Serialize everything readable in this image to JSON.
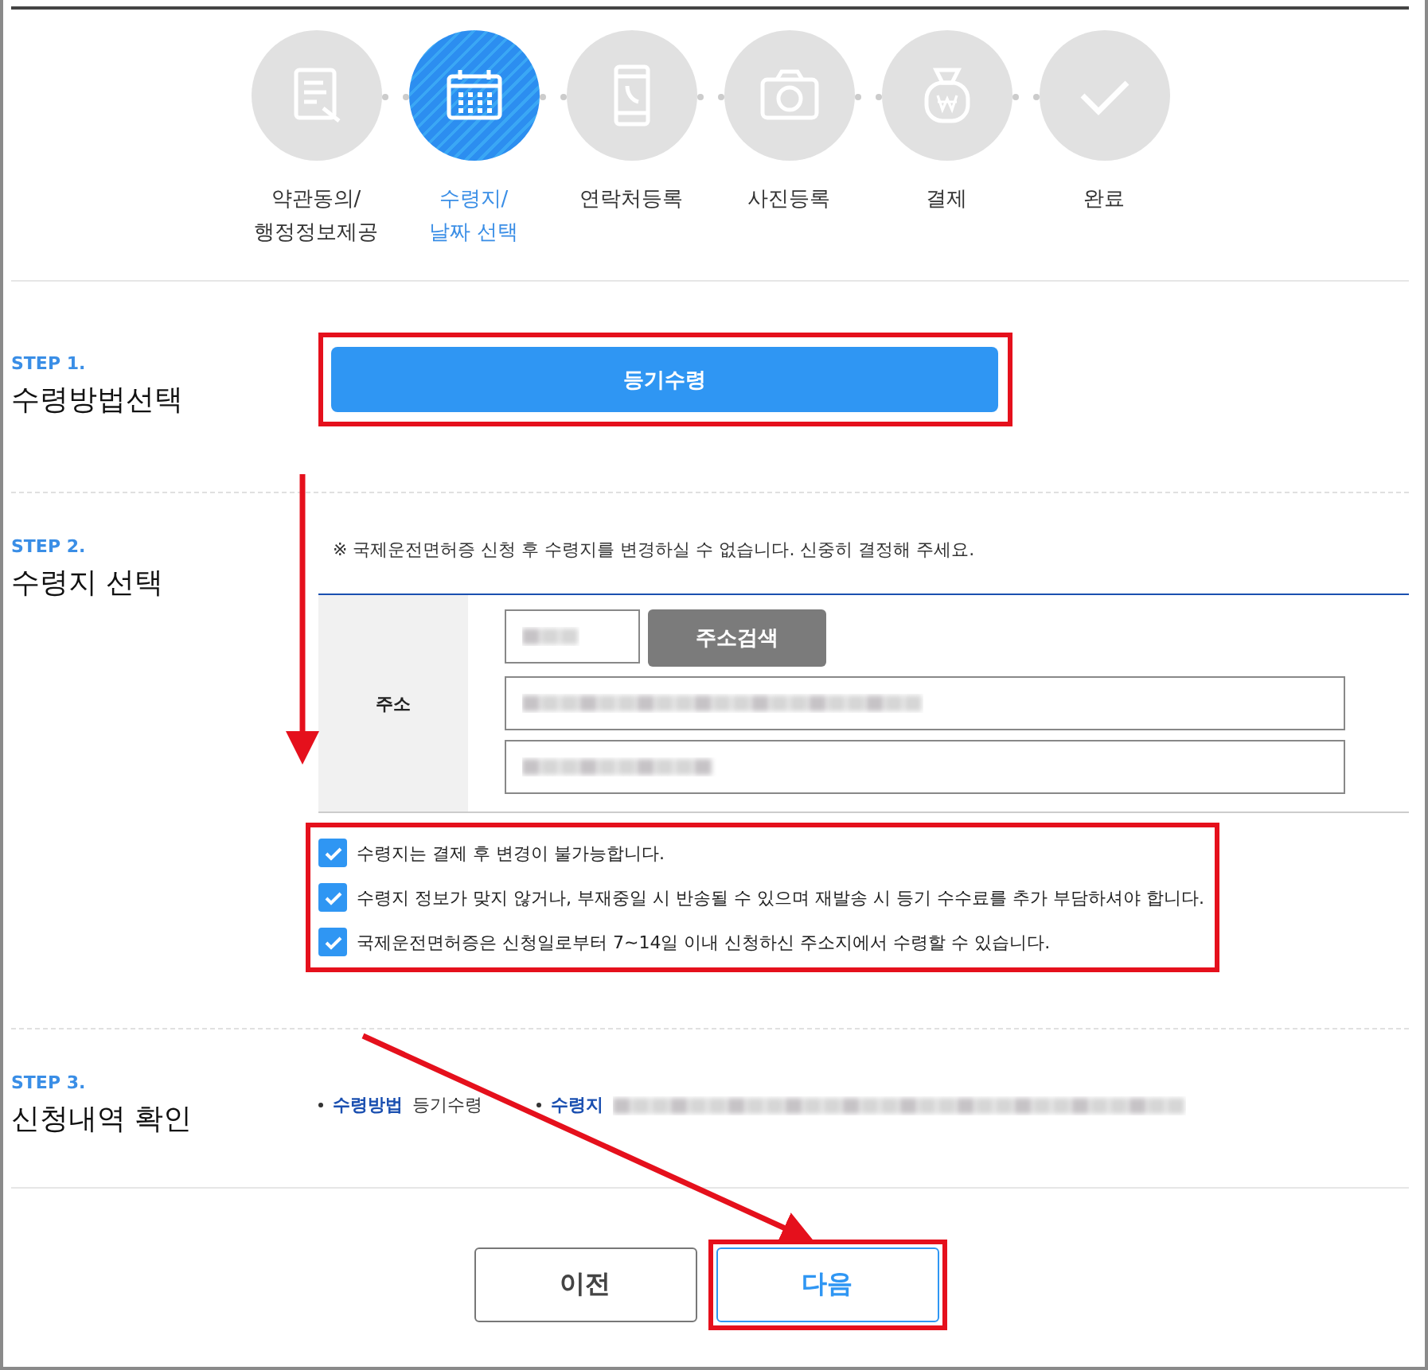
{
  "progress": [
    {
      "label": "약관동의/\n행정정보제공",
      "selected": false
    },
    {
      "label": "수령지/\n날짜 선택",
      "selected": true
    },
    {
      "label": "연락처등록",
      "selected": false
    },
    {
      "label": "사진등록",
      "selected": false
    },
    {
      "label": "결제",
      "selected": false
    },
    {
      "label": "완료",
      "selected": false
    }
  ],
  "step1": {
    "step": "STEP 1.",
    "title": "수령방법선택",
    "method_button": "등기수령"
  },
  "step2": {
    "step": "STEP 2.",
    "title": "수령지 선택",
    "notice": "※ 국제운전면허증 신청 후 수령지를 변경하실 수 없습니다. 신중히 결정해 주세요.",
    "address_label": "주소",
    "search_button": "주소검색",
    "agreements": [
      {
        "text": "수령지는 결제 후 변경이 불가능합니다.",
        "checked": true
      },
      {
        "text": "수령지 정보가 맞지 않거나, 부재중일 시 반송될 수 있으며 재발송 시 등기 수수료를 추가 부담하셔야 합니다.",
        "checked": true
      },
      {
        "text": "국제운전면허증은 신청일로부터 7~14일 이내 신청하신 주소지에서 수령할 수 있습니다.",
        "checked": true
      }
    ]
  },
  "step3": {
    "step": "STEP 3.",
    "title": "신청내역 확인",
    "summary": [
      {
        "label": "수령방법",
        "value": "등기수령"
      },
      {
        "label": "수령지"
      }
    ]
  },
  "buttons": [
    {
      "label": "이전",
      "kind": "prev"
    },
    {
      "label": "다음",
      "kind": "next"
    }
  ]
}
